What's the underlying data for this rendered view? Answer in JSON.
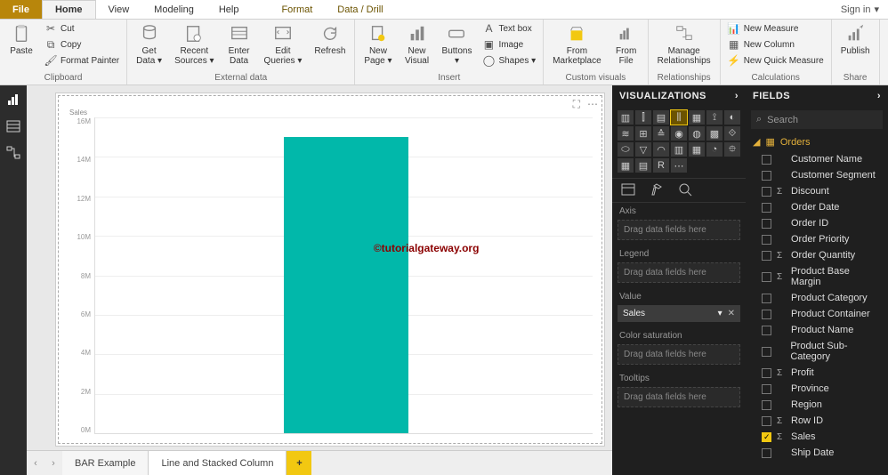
{
  "menu": {
    "file": "File",
    "home": "Home",
    "view": "View",
    "modeling": "Modeling",
    "help": "Help",
    "format": "Format",
    "datadrill": "Data / Drill",
    "signin": "Sign in"
  },
  "ribbon": {
    "clipboard": {
      "label": "Clipboard",
      "paste": "Paste",
      "cut": "Cut",
      "copy": "Copy",
      "formatpainter": "Format Painter"
    },
    "external": {
      "label": "External data",
      "getdata": "Get\nData ▾",
      "recent": "Recent\nSources ▾",
      "enter": "Enter\nData",
      "edit": "Edit\nQueries ▾",
      "refresh": "Refresh"
    },
    "insert": {
      "label": "Insert",
      "newpage": "New\nPage ▾",
      "newvisual": "New\nVisual",
      "buttons": "Buttons\n▾",
      "textbox": "Text box",
      "image": "Image",
      "shapes": "Shapes ▾"
    },
    "custom": {
      "label": "Custom visuals",
      "marketplace": "From\nMarketplace",
      "fromfile": "From\nFile"
    },
    "relationships": {
      "label": "Relationships",
      "manage": "Manage\nRelationships"
    },
    "calculations": {
      "label": "Calculations",
      "newmeasure": "New Measure",
      "newcolumn": "New Column",
      "newquick": "New Quick Measure"
    },
    "share": {
      "label": "Share",
      "publish": "Publish"
    }
  },
  "vis": {
    "title": "VISUALIZATIONS",
    "wells": {
      "axis": "Axis",
      "legend": "Legend",
      "value": "Value",
      "colorsat": "Color saturation",
      "tooltips": "Tooltips",
      "drag": "Drag data fields here",
      "chip": "Sales"
    }
  },
  "fields": {
    "title": "FIELDS",
    "search": "Search",
    "table": "Orders",
    "items": [
      {
        "name": "Customer Name",
        "sigma": false,
        "checked": false
      },
      {
        "name": "Customer Segment",
        "sigma": false,
        "checked": false
      },
      {
        "name": "Discount",
        "sigma": true,
        "checked": false
      },
      {
        "name": "Order Date",
        "sigma": false,
        "checked": false
      },
      {
        "name": "Order ID",
        "sigma": false,
        "checked": false
      },
      {
        "name": "Order Priority",
        "sigma": false,
        "checked": false
      },
      {
        "name": "Order Quantity",
        "sigma": true,
        "checked": false
      },
      {
        "name": "Product Base Margin",
        "sigma": true,
        "checked": false
      },
      {
        "name": "Product Category",
        "sigma": false,
        "checked": false
      },
      {
        "name": "Product Container",
        "sigma": false,
        "checked": false
      },
      {
        "name": "Product Name",
        "sigma": false,
        "checked": false
      },
      {
        "name": "Product Sub-Category",
        "sigma": false,
        "checked": false
      },
      {
        "name": "Profit",
        "sigma": true,
        "checked": false
      },
      {
        "name": "Province",
        "sigma": false,
        "checked": false
      },
      {
        "name": "Region",
        "sigma": false,
        "checked": false
      },
      {
        "name": "Row ID",
        "sigma": true,
        "checked": false
      },
      {
        "name": "Sales",
        "sigma": true,
        "checked": true
      },
      {
        "name": "Ship Date",
        "sigma": false,
        "checked": false
      }
    ]
  },
  "pages": {
    "tab1": "BAR Example",
    "tab2": "Line and Stacked Column"
  },
  "watermark": "©tutorialgateway.org",
  "chart_data": {
    "type": "bar",
    "title": "",
    "ylabel": "Sales",
    "xlabel": "",
    "ylim": [
      0,
      16000000
    ],
    "yticks": [
      "16M",
      "14M",
      "12M",
      "10M",
      "8M",
      "6M",
      "4M",
      "2M",
      "0M"
    ],
    "categories": [
      ""
    ],
    "values": [
      15000000
    ]
  }
}
